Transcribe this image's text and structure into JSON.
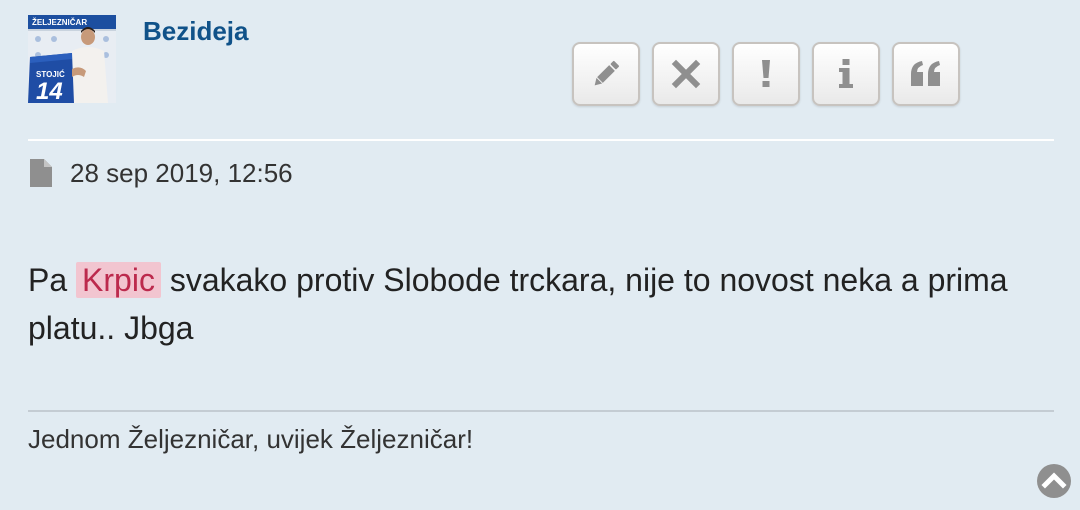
{
  "post": {
    "author": "Bezideja",
    "date": "28 sep 2019, 12:56",
    "content_pre": "Pa ",
    "content_highlight": "Krpic",
    "content_post": " svakako protiv Slobode trckara, nije to novost neka a prima platu.. Jbga",
    "signature": "Jednom Željezničar, uvijek Željezničar!"
  },
  "avatar": {
    "banner_text": "ŽELJEZNIČAR",
    "shirt_name": "STOJIĆ",
    "shirt_number": "14"
  },
  "toolbar": {
    "buttons": [
      {
        "icon": "pencil-icon",
        "action": "edit"
      },
      {
        "icon": "close-icon",
        "action": "delete"
      },
      {
        "icon": "exclamation-icon",
        "action": "report"
      },
      {
        "icon": "info-icon",
        "action": "information"
      },
      {
        "icon": "quote-icon",
        "action": "quote"
      }
    ]
  },
  "colors": {
    "background": "#e1ebf2",
    "username": "#105289",
    "highlight_bg": "#f2c5d0",
    "highlight_text": "#bc2a4d",
    "icon": "#8f8f8f"
  }
}
